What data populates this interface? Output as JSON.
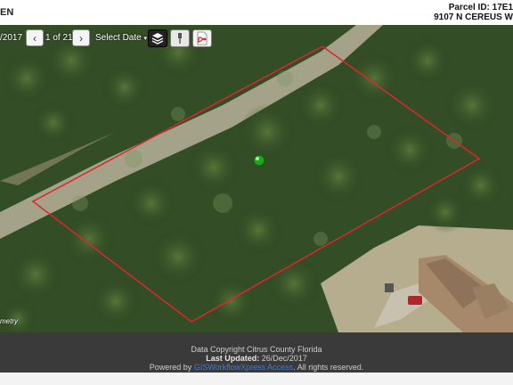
{
  "header": {
    "left_text": "EN",
    "parcel_label": "Parcel ID: 17E1",
    "address": "9107 N CEREUS W"
  },
  "toolbar": {
    "date": "/2017",
    "prev_icon": "chevron-left-icon",
    "count": "1 of 21",
    "next_icon": "chevron-right-icon",
    "select_label": "Select Date",
    "layers_icon": "layers-icon",
    "pin_icon": "pin-icon",
    "pdf_icon": "pdf-icon"
  },
  "map": {
    "metric_label": "metry",
    "parcel_outline_color": "#e0262a",
    "marker_color": "#1fa51f"
  },
  "footer": {
    "copyright": "Data Copyright Citrus County Florida",
    "last_updated_label": "Last Updated:",
    "last_updated_date": "26/Dec/2017",
    "powered_by": "Powered by",
    "powered_link": "GISWorkflowXpress Access",
    "rights": ". All rights reserved."
  }
}
